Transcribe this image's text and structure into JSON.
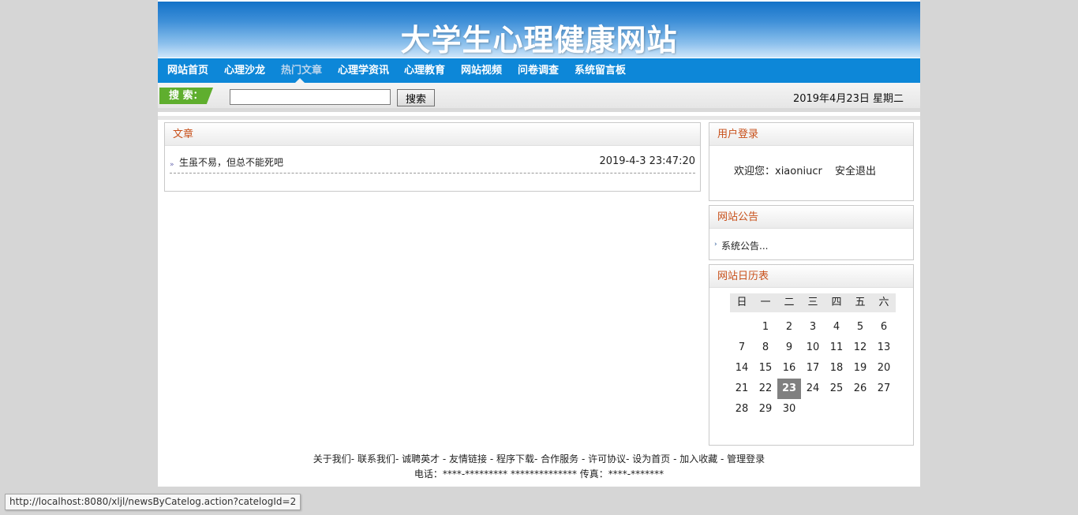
{
  "header": {
    "title": "大学生心理健康网站"
  },
  "nav": {
    "items": [
      {
        "label": "网站首页"
      },
      {
        "label": "心理沙龙"
      },
      {
        "label": "热门文章"
      },
      {
        "label": "心理学资讯"
      },
      {
        "label": "心理教育"
      },
      {
        "label": "网站视频"
      },
      {
        "label": "问卷调查"
      },
      {
        "label": "系统留言板"
      }
    ],
    "active": "热门文章"
  },
  "search": {
    "label": "搜 索：",
    "input_value": "",
    "button_label": "搜索"
  },
  "date": "2019年4月23日 星期二",
  "articles": {
    "heading": "文章",
    "items": [
      {
        "title": "生虽不易，但总不能死吧",
        "date": "2019-4-3 23:47:20"
      }
    ]
  },
  "login": {
    "heading": "用户登录",
    "welcome": "欢迎您：xiaoniucr",
    "logout": "安全退出"
  },
  "notice": {
    "heading": "网站公告",
    "items": [
      "系统公告..."
    ]
  },
  "calendar": {
    "heading": "网站日历表",
    "weekdays": [
      "日",
      "一",
      "二",
      "三",
      "四",
      "五",
      "六"
    ],
    "first_weekday": 1,
    "days_in_month": 30,
    "today": 23
  },
  "footer": {
    "links": "关于我们- 联系我们- 诚聘英才 - 友情链接 - 程序下载- 合作服务 - 许可协议- 设为首页 - 加入收藏 - 管理登录",
    "contact": "电话：****-********* ************** 传真：****-*******"
  },
  "status_url": "http://localhost:8080/xljl/newsByCatelog.action?catelogId=2",
  "colors": {
    "nav": "#0d87d8",
    "panel_heading": "#c8501a",
    "search_label": "#5fae2e",
    "today": "#808080"
  }
}
